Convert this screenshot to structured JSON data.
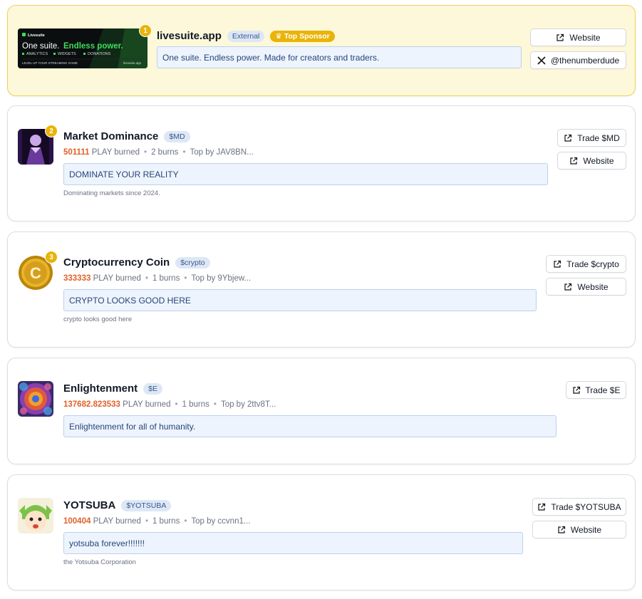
{
  "sponsor": {
    "rank": "1",
    "banner": {
      "brand": "Livesuite",
      "headline_a": "One suite.",
      "headline_b": "Endless power.",
      "features": [
        "ANALYTICS",
        "WIDGETS",
        "DONATIONS"
      ],
      "tagline": "LEVEL UP YOUR STREAMING GAME",
      "domain": "livesuite.app"
    },
    "title": "livesuite.app",
    "tag_external": "External",
    "tag_sponsor": "Top Sponsor",
    "message": "One suite. Endless power. Made for creators and traders.",
    "website_label": "Website",
    "x_label": "@thenumberdude"
  },
  "tokens": [
    {
      "rank": "2",
      "name": "Market Dominance",
      "ticker": "$MD",
      "burned": "501111",
      "burned_suffix": "PLAY burned",
      "burns": "2 burns",
      "top": "Top by JAV8BN...",
      "message": "DOMINATE YOUR REALITY",
      "sub": "Dominating markets since 2024.",
      "trade_label": "Trade $MD",
      "website_label": "Website"
    },
    {
      "rank": "3",
      "name": "Cryptocurrency Coin",
      "ticker": "$crypto",
      "burned": "333333",
      "burned_suffix": "PLAY burned",
      "burns": "1 burns",
      "top": "Top by 9Ybjew...",
      "message": "CRYPTO LOOKS GOOD HERE",
      "sub": "crypto looks good here",
      "trade_label": "Trade $crypto",
      "website_label": "Website"
    },
    {
      "name": "Enlightenment",
      "ticker": "$E",
      "burned": "137682.823533",
      "burned_suffix": "PLAY burned",
      "burns": "1 burns",
      "top": "Top by 2ttv8T...",
      "message": "Enlightenment for all of humanity.",
      "trade_label": "Trade $E"
    },
    {
      "name": "YOTSUBA",
      "ticker": "$YOTSUBA",
      "burned": "100404",
      "burned_suffix": "PLAY burned",
      "burns": "1 burns",
      "top": "Top by ccvnn1...",
      "message": "yotsuba forever!!!!!!!",
      "sub": "the Yotsuba Corporation",
      "trade_label": "Trade $YOTSUBA",
      "website_label": "Website"
    }
  ],
  "colors": {
    "burn": "#e0612a",
    "rank_badge": "#eab308",
    "sponsor_bg": "#fdf8d9",
    "tag_bg": "#dde7f6"
  }
}
